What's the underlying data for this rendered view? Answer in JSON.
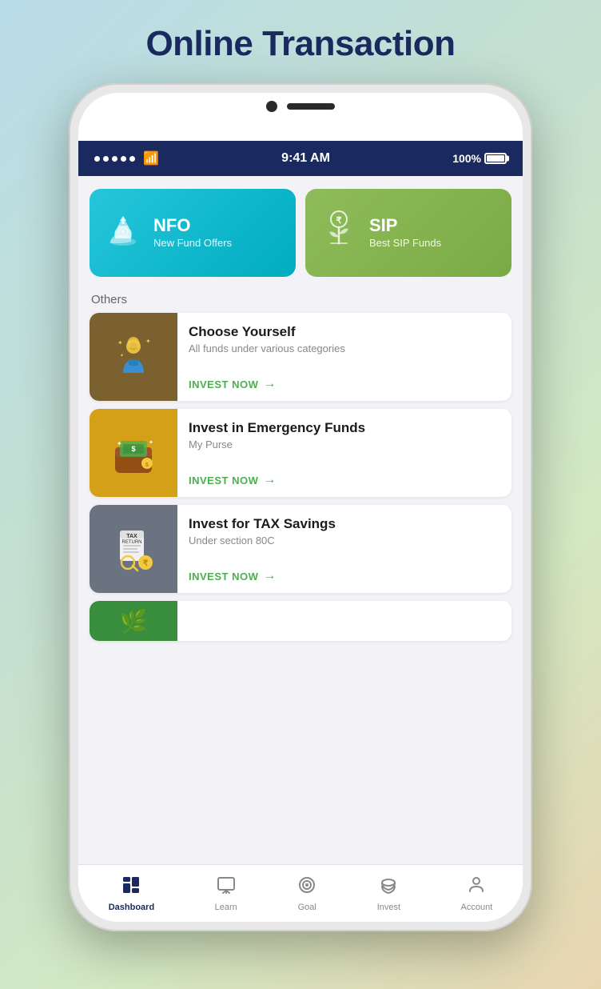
{
  "page": {
    "title": "Online Transaction",
    "background": "linear-gradient(135deg, #b8dce8 0%, #c5e0d0 40%, #d4e8c2 70%, #e8d5b0 100%)"
  },
  "status_bar": {
    "time": "9:41 AM",
    "battery": "100%"
  },
  "top_cards": [
    {
      "id": "nfo",
      "title": "NFO",
      "subtitle": "New Fund Offers",
      "icon": "💰"
    },
    {
      "id": "sip",
      "title": "SIP",
      "subtitle": "Best SIP Funds",
      "icon": "🌱"
    }
  ],
  "others_label": "Others",
  "list_items": [
    {
      "id": "choose-yourself",
      "title": "Choose Yourself",
      "subtitle": "All funds under various categories",
      "cta": "INVEST NOW",
      "icon": "🧠",
      "bg_class": "img-brown"
    },
    {
      "id": "emergency-funds",
      "title": "Invest in Emergency Funds",
      "subtitle": "My Purse",
      "cta": "INVEST NOW",
      "icon": "👜",
      "bg_class": "img-gold"
    },
    {
      "id": "tax-savings",
      "title": "Invest for TAX Savings",
      "subtitle": "Under section 80C",
      "cta": "INVEST NOW",
      "icon": "📋",
      "bg_class": "img-gray"
    }
  ],
  "tabs": [
    {
      "id": "dashboard",
      "label": "Dashboard",
      "icon": "grid",
      "active": true
    },
    {
      "id": "learn",
      "label": "Learn",
      "icon": "monitor",
      "active": false
    },
    {
      "id": "goal",
      "label": "Goal",
      "icon": "target",
      "active": false
    },
    {
      "id": "invest",
      "label": "Invest",
      "icon": "piggy",
      "active": false
    },
    {
      "id": "account",
      "label": "Account",
      "icon": "person",
      "active": false
    }
  ]
}
